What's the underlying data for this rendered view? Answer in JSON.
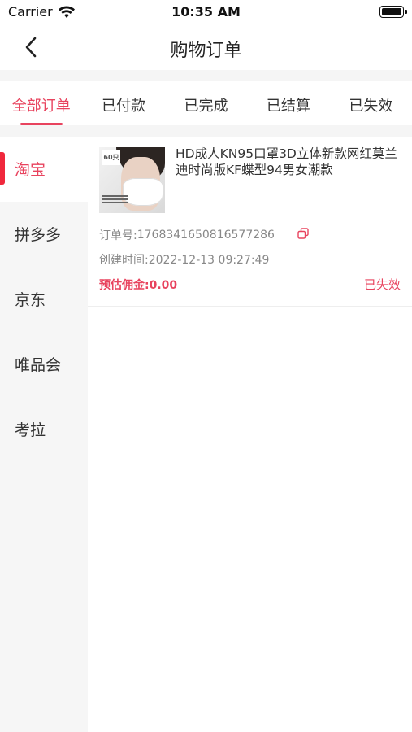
{
  "status_bar": {
    "carrier": "Carrier",
    "time": "10:35 AM"
  },
  "nav": {
    "title": "购物订单",
    "back_icon": "chevron-left-icon"
  },
  "tabs": [
    {
      "label": "全部订单",
      "active": true
    },
    {
      "label": "已付款",
      "active": false
    },
    {
      "label": "已完成",
      "active": false
    },
    {
      "label": "已结算",
      "active": false
    },
    {
      "label": "已失效",
      "active": false
    }
  ],
  "sidebar": {
    "items": [
      {
        "label": "淘宝",
        "active": true
      },
      {
        "label": "拼多多",
        "active": false
      },
      {
        "label": "京东",
        "active": false
      },
      {
        "label": "唯品会",
        "active": false
      },
      {
        "label": "考拉",
        "active": false
      }
    ]
  },
  "orders": [
    {
      "thumb_tag": "60只",
      "title": "HD成人KN95口罩3D立体新款网红莫兰迪时尚版KF蝶型94男女潮款",
      "order_no_label": "订单号:",
      "order_no": "1768341650816577286",
      "created_label": "创建时间:",
      "created": "2022-12-13 09:27:49",
      "commission_label": "预估佣金:",
      "commission": "0.00",
      "status": "已失效"
    }
  ],
  "colors": {
    "accent": "#e8435e",
    "indicator": "#f0283c",
    "background_gray": "#f5f5f5"
  }
}
